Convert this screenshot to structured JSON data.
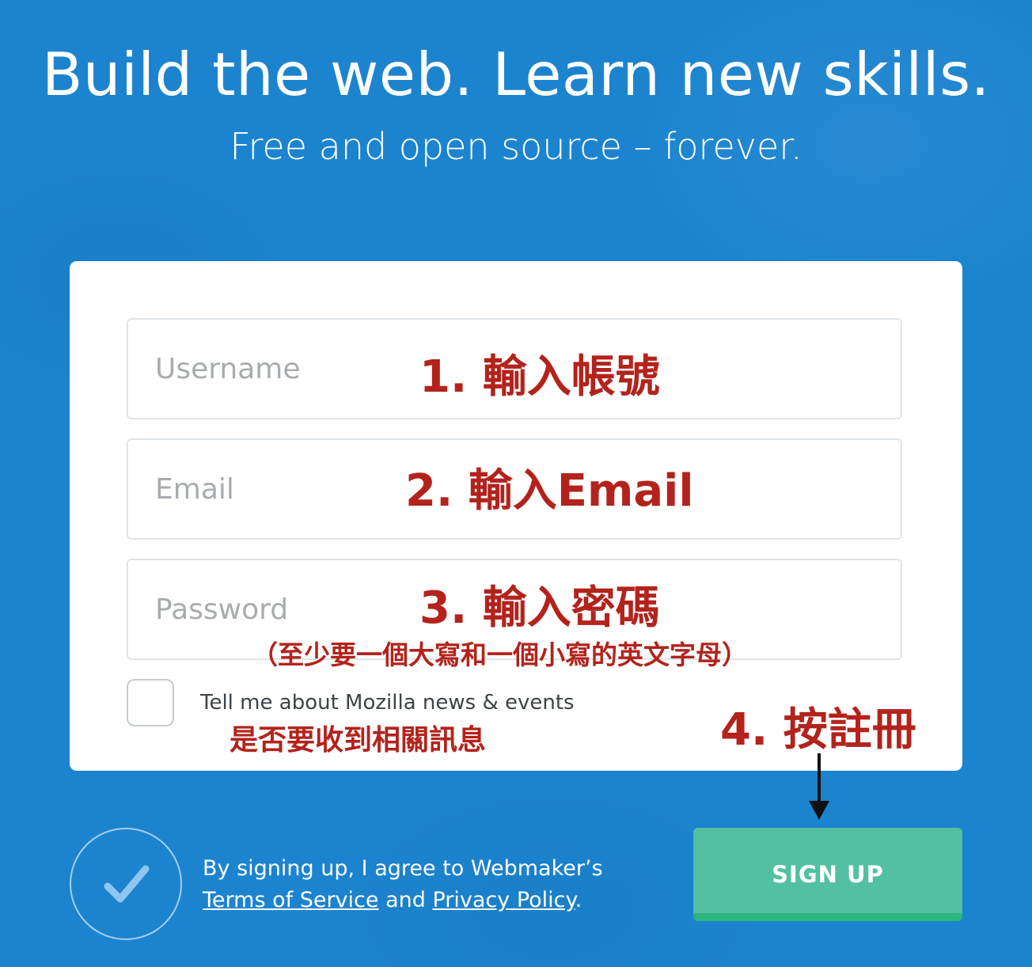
{
  "header": {
    "title": "Build the web. Learn new skills.",
    "subtitle": "Free and open source – forever."
  },
  "form": {
    "username_placeholder": "Username",
    "email_placeholder": "Email",
    "password_placeholder": "Password",
    "newsletter_label": "Tell me about Mozilla news & events",
    "newsletter_checked": false
  },
  "annotations": {
    "step1": "1. 輸入帳號",
    "step2": "2. 輸入Email",
    "step3": "3. 輸入密碼",
    "step3_note": "（至少要一個大寫和一個小寫的英文字母）",
    "checkbox_note": "是否要收到相關訊息",
    "step4": "4. 按註冊"
  },
  "footer": {
    "agree_text": "By signing up, I agree to Webmaker’s",
    "terms_link": "Terms of Service",
    "and_text": "and",
    "privacy_link": "Privacy Policy",
    "period": ".",
    "signup_label": "SIGN UP"
  },
  "colors": {
    "background": "#1c84cf",
    "annotation": "#b3231c",
    "signup_button": "#52c0a1"
  },
  "icons": {
    "agree_badge": "checkmark-icon",
    "pointer": "arrow-down-icon"
  }
}
